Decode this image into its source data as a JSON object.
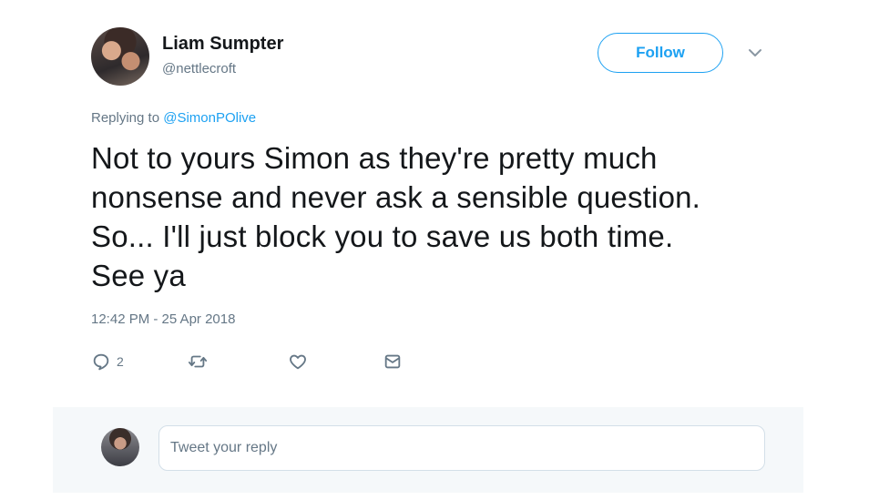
{
  "author": {
    "display_name": "Liam Sumpter",
    "handle": "@nettlecroft"
  },
  "follow_button": {
    "label": "Follow"
  },
  "replying_to": {
    "prefix": "Replying to",
    "mention": "@SimonPOlive"
  },
  "tweet": {
    "lines": [
      "Not to yours Simon as they're pretty much",
      "nonsense and never ask a sensible question.",
      "So... I'll just block you to save us both time.",
      "See ya"
    ],
    "timestamp": "12:42 PM - 25 Apr 2018"
  },
  "actions": {
    "reply_count": "2",
    "icons": [
      "reply-icon",
      "retweet-icon",
      "like-icon",
      "direct-message-icon"
    ]
  },
  "reply_box": {
    "placeholder": "Tweet your reply"
  },
  "colors": {
    "accent": "#1da1f2",
    "secondary_text": "#657786",
    "text": "#14171a",
    "reply_bar_bg": "#f5f8fa"
  }
}
